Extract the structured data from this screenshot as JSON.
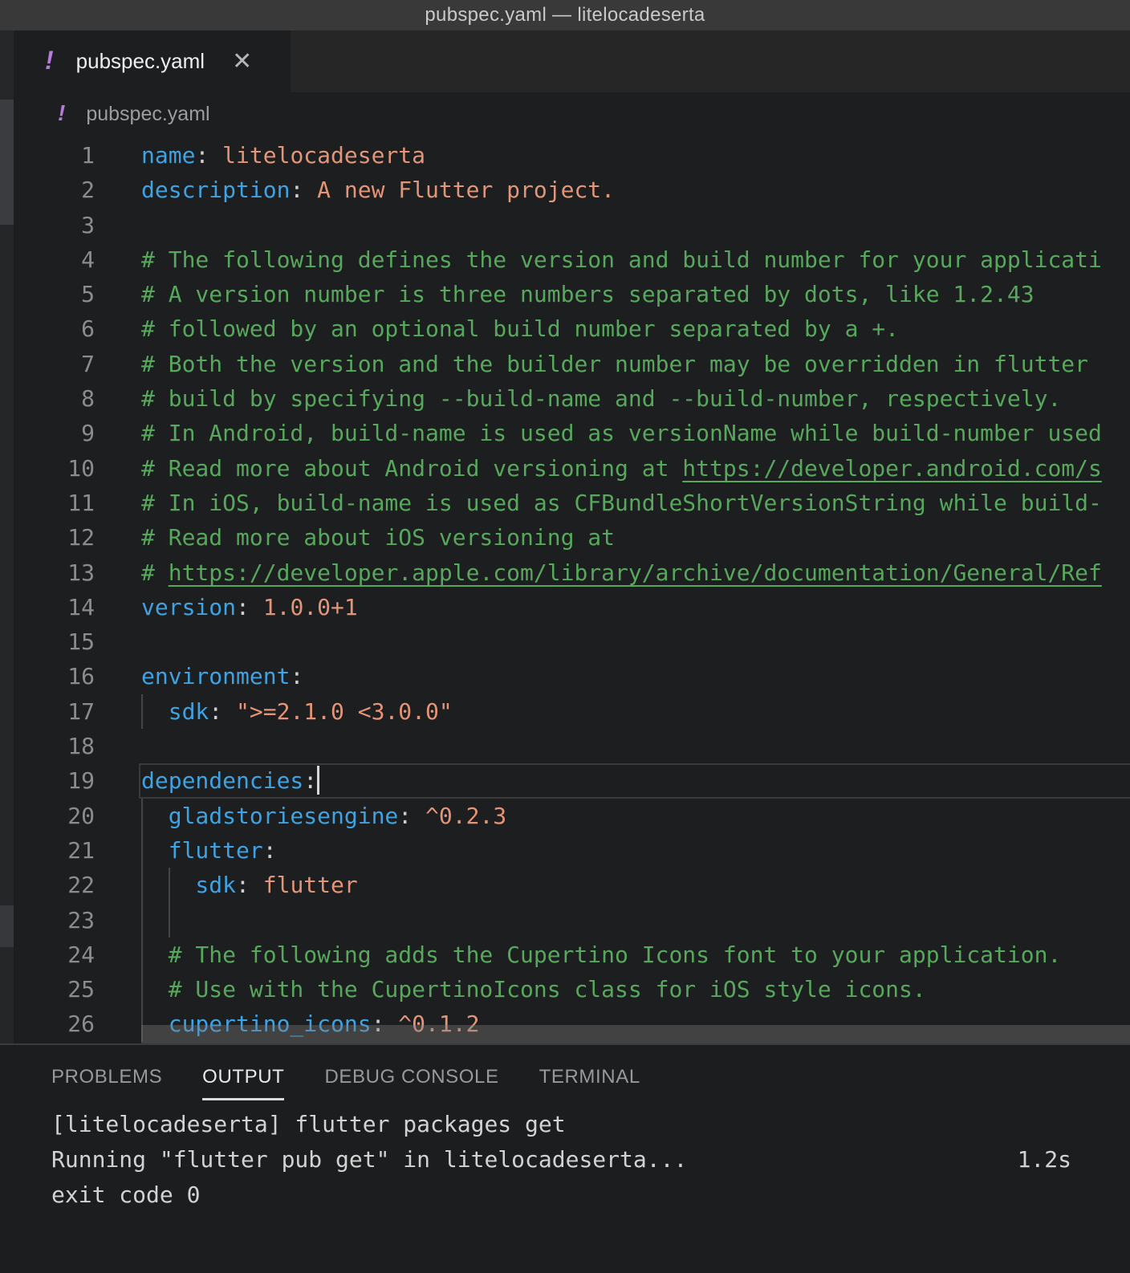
{
  "title_bar": {
    "title": "pubspec.yaml — litelocadeserta"
  },
  "tab": {
    "icon": "!",
    "label": "pubspec.yaml",
    "close": "✕"
  },
  "breadcrumb": {
    "icon": "!",
    "label": "pubspec.yaml"
  },
  "colors": {
    "key_blue": "#3fa2e2",
    "string_salmon": "#e29578",
    "comment_green": "#57a75c",
    "icon_purple": "#b57bd8",
    "titlebar_bg": "#39393a",
    "editor_bg": "#1d1e1f",
    "tabstrip_bg": "#262627",
    "active_panel_tab": "#e9e9e9"
  },
  "editor": {
    "lines": [
      {
        "num": 1,
        "tokens": [
          {
            "c": "key",
            "t": "name"
          },
          {
            "c": "punc",
            "t": ":"
          },
          {
            "c": "str",
            "t": " litelocadeserta"
          }
        ]
      },
      {
        "num": 2,
        "tokens": [
          {
            "c": "key",
            "t": "description"
          },
          {
            "c": "punc",
            "t": ":"
          },
          {
            "c": "str",
            "t": " A new Flutter project."
          }
        ]
      },
      {
        "num": 3,
        "tokens": []
      },
      {
        "num": 4,
        "tokens": [
          {
            "c": "com",
            "t": "# The following defines the version and build number for your applicati"
          }
        ]
      },
      {
        "num": 5,
        "tokens": [
          {
            "c": "com",
            "t": "# A version number is three numbers separated by dots, like 1.2.43"
          }
        ]
      },
      {
        "num": 6,
        "tokens": [
          {
            "c": "com",
            "t": "# followed by an optional build number separated by a +."
          }
        ]
      },
      {
        "num": 7,
        "tokens": [
          {
            "c": "com",
            "t": "# Both the version and the builder number may be overridden in flutter"
          }
        ]
      },
      {
        "num": 8,
        "tokens": [
          {
            "c": "com",
            "t": "# build by specifying --build-name and --build-number, respectively."
          }
        ]
      },
      {
        "num": 9,
        "tokens": [
          {
            "c": "com",
            "t": "# In Android, build-name is used as versionName while build-number used"
          }
        ]
      },
      {
        "num": 10,
        "tokens": [
          {
            "c": "com",
            "t": "# Read more about Android versioning at "
          },
          {
            "c": "lnk",
            "t": "https://developer.android.com/s"
          }
        ]
      },
      {
        "num": 11,
        "tokens": [
          {
            "c": "com",
            "t": "# In iOS, build-name is used as CFBundleShortVersionString while build-"
          }
        ]
      },
      {
        "num": 12,
        "tokens": [
          {
            "c": "com",
            "t": "# Read more about iOS versioning at"
          }
        ]
      },
      {
        "num": 13,
        "tokens": [
          {
            "c": "com",
            "t": "# "
          },
          {
            "c": "lnk",
            "t": "https://developer.apple.com/library/archive/documentation/General/Ref"
          }
        ]
      },
      {
        "num": 14,
        "tokens": [
          {
            "c": "key",
            "t": "version"
          },
          {
            "c": "punc",
            "t": ":"
          },
          {
            "c": "str",
            "t": " 1.0.0+1"
          }
        ]
      },
      {
        "num": 15,
        "tokens": []
      },
      {
        "num": 16,
        "tokens": [
          {
            "c": "key",
            "t": "environment"
          },
          {
            "c": "punc",
            "t": ":"
          }
        ]
      },
      {
        "num": 17,
        "guides": [
          0
        ],
        "tokens": [
          {
            "c": "key",
            "t": "  sdk"
          },
          {
            "c": "punc",
            "t": ":"
          },
          {
            "c": "str",
            "t": " \">=2.1.0 <3.0.0\""
          }
        ]
      },
      {
        "num": 18,
        "tokens": []
      },
      {
        "num": 19,
        "current": true,
        "cursor": true,
        "tokens": [
          {
            "c": "key",
            "t": "dependencies"
          },
          {
            "c": "punc",
            "t": ":"
          }
        ]
      },
      {
        "num": 20,
        "guides": [
          0
        ],
        "tokens": [
          {
            "c": "key",
            "t": "  gladstoriesengine"
          },
          {
            "c": "punc",
            "t": ":"
          },
          {
            "c": "str",
            "t": " ^0.2.3"
          }
        ]
      },
      {
        "num": 21,
        "guides": [
          0
        ],
        "tokens": [
          {
            "c": "key",
            "t": "  flutter"
          },
          {
            "c": "punc",
            "t": ":"
          }
        ]
      },
      {
        "num": 22,
        "guides": [
          0,
          2
        ],
        "tokens": [
          {
            "c": "key",
            "t": "    sdk"
          },
          {
            "c": "punc",
            "t": ":"
          },
          {
            "c": "str",
            "t": " flutter"
          }
        ]
      },
      {
        "num": 23,
        "guides": [
          0,
          2
        ],
        "tokens": []
      },
      {
        "num": 24,
        "guides": [
          0
        ],
        "tokens": [
          {
            "c": "com",
            "t": "  # The following adds the Cupertino Icons font to your application."
          }
        ]
      },
      {
        "num": 25,
        "guides": [
          0
        ],
        "tokens": [
          {
            "c": "com",
            "t": "  # Use with the CupertinoIcons class for iOS style icons."
          }
        ]
      },
      {
        "num": 26,
        "guides": [
          0
        ],
        "tokens": [
          {
            "c": "key",
            "t": "  cupertino_icons"
          },
          {
            "c": "punc",
            "t": ":"
          },
          {
            "c": "str",
            "t": " ^0.1.2"
          }
        ]
      }
    ]
  },
  "panel": {
    "tabs": [
      {
        "label": "PROBLEMS",
        "active": false
      },
      {
        "label": "OUTPUT",
        "active": true
      },
      {
        "label": "DEBUG CONSOLE",
        "active": false
      },
      {
        "label": "TERMINAL",
        "active": false
      }
    ],
    "output_rows": [
      {
        "text": "[litelocadeserta] flutter packages get"
      },
      {
        "text": "Running \"flutter pub get\" in litelocadeserta...",
        "time": "1.2s"
      },
      {
        "text": "exit code 0"
      }
    ]
  }
}
